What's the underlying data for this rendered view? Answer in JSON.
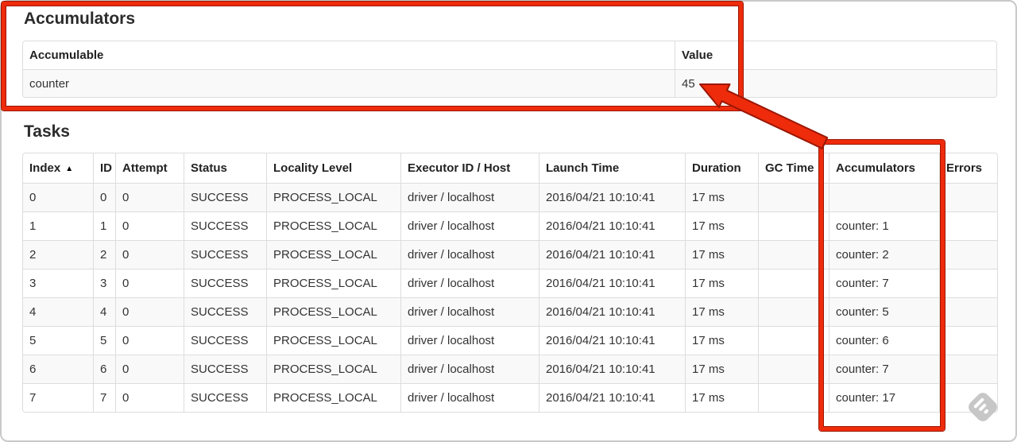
{
  "page": {
    "accumulators": {
      "title": "Accumulators",
      "columns": [
        "Accumulable",
        "Value"
      ],
      "rows": [
        [
          "counter",
          "45"
        ]
      ]
    },
    "tasks": {
      "title": "Tasks",
      "columns": [
        "Index",
        "ID",
        "Attempt",
        "Status",
        "Locality Level",
        "Executor ID / Host",
        "Launch Time",
        "Duration",
        "GC Time",
        "Accumulators",
        "Errors"
      ],
      "rows": [
        [
          "0",
          "0",
          "0",
          "SUCCESS",
          "PROCESS_LOCAL",
          "driver / localhost",
          "2016/04/21 10:10:41",
          "17 ms",
          "",
          "",
          ""
        ],
        [
          "1",
          "1",
          "0",
          "SUCCESS",
          "PROCESS_LOCAL",
          "driver / localhost",
          "2016/04/21 10:10:41",
          "17 ms",
          "",
          "counter: 1",
          ""
        ],
        [
          "2",
          "2",
          "0",
          "SUCCESS",
          "PROCESS_LOCAL",
          "driver / localhost",
          "2016/04/21 10:10:41",
          "17 ms",
          "",
          "counter: 2",
          ""
        ],
        [
          "3",
          "3",
          "0",
          "SUCCESS",
          "PROCESS_LOCAL",
          "driver / localhost",
          "2016/04/21 10:10:41",
          "17 ms",
          "",
          "counter: 7",
          ""
        ],
        [
          "4",
          "4",
          "0",
          "SUCCESS",
          "PROCESS_LOCAL",
          "driver / localhost",
          "2016/04/21 10:10:41",
          "17 ms",
          "",
          "counter: 5",
          ""
        ],
        [
          "5",
          "5",
          "0",
          "SUCCESS",
          "PROCESS_LOCAL",
          "driver / localhost",
          "2016/04/21 10:10:41",
          "17 ms",
          "",
          "counter: 6",
          ""
        ],
        [
          "6",
          "6",
          "0",
          "SUCCESS",
          "PROCESS_LOCAL",
          "driver / localhost",
          "2016/04/21 10:10:41",
          "17 ms",
          "",
          "counter: 7",
          ""
        ],
        [
          "7",
          "7",
          "0",
          "SUCCESS",
          "PROCESS_LOCAL",
          "driver / localhost",
          "2016/04/21 10:10:41",
          "17 ms",
          "",
          "counter: 17",
          ""
        ]
      ]
    },
    "icons": {
      "sort_ascending": "▲",
      "watermark": "diamond-stripes-icon"
    },
    "colors": {
      "annotation_red": "#ee2b0b",
      "annotation_outline": "#9b1703",
      "stripe_row": "#f9f9f9",
      "table_border": "#dddddd"
    }
  }
}
